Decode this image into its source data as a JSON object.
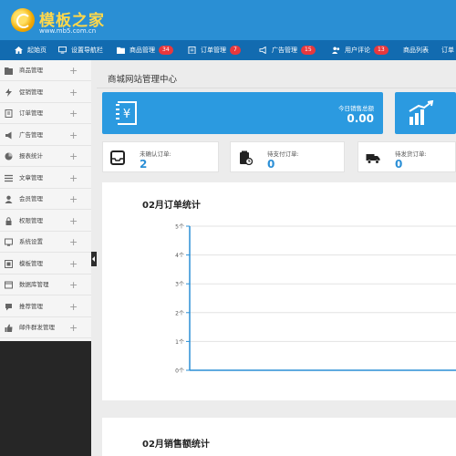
{
  "header": {
    "logo_title": "模板之家",
    "logo_sub": "www.mb5.com.cn"
  },
  "topnav": [
    {
      "label": "起始页",
      "icon": "home-icon"
    },
    {
      "label": "设置导航栏",
      "icon": "monitor-icon"
    },
    {
      "label": "商品管理",
      "icon": "folder-icon",
      "badge": "34"
    },
    {
      "label": "订单管理",
      "icon": "clipboard-icon",
      "badge": "7"
    },
    {
      "label": "广告管理",
      "icon": "megaphone-icon",
      "badge": "15"
    },
    {
      "label": "用户评论",
      "icon": "users-icon",
      "badge": "13"
    },
    {
      "label": "商品列表",
      "icon": ""
    },
    {
      "label": "订单",
      "icon": ""
    }
  ],
  "sidebar": {
    "items": [
      {
        "label": "商品管理",
        "icon": "folder-icon"
      },
      {
        "label": "促销管理",
        "icon": "flash-icon"
      },
      {
        "label": "订单管理",
        "icon": "doc-icon"
      },
      {
        "label": "广告管理",
        "icon": "megaphone-icon"
      },
      {
        "label": "报表统计",
        "icon": "chart-icon"
      },
      {
        "label": "文章管理",
        "icon": "list-icon"
      },
      {
        "label": "会员管理",
        "icon": "user-icon"
      },
      {
        "label": "权限管理",
        "icon": "lock-icon"
      },
      {
        "label": "系统设置",
        "icon": "settings-icon"
      },
      {
        "label": "模板管理",
        "icon": "template-icon"
      },
      {
        "label": "数据库管理",
        "icon": "database-icon"
      },
      {
        "label": "推荐管理",
        "icon": "recommend-icon"
      },
      {
        "label": "邮件群发管理",
        "icon": "thumb-icon"
      }
    ],
    "plus": "+"
  },
  "main": {
    "page_title": "商城网站管理中心",
    "stats": [
      {
        "label": "今日销售总额",
        "value": "0.00",
        "icon": "money-icon"
      },
      {
        "label": "",
        "value": "",
        "icon": "growth-icon"
      }
    ],
    "orders": [
      {
        "label": "未确认订单:",
        "value": "2",
        "icon": "box-icon"
      },
      {
        "label": "待支付订单:",
        "value": "0",
        "icon": "payment-icon"
      },
      {
        "label": "待发货订单:",
        "value": "0",
        "icon": "truck-icon"
      }
    ]
  },
  "charts": {
    "order_title": "02月订单统计",
    "sales_title": "02月销售额统计"
  },
  "chart_data": {
    "type": "line",
    "title": "02月订单统计",
    "xlabel": "",
    "ylabel": "",
    "y_ticks": [
      "0个",
      "1个",
      "2个",
      "3个",
      "4个",
      "5个"
    ],
    "ylim": [
      0,
      5
    ],
    "x": [],
    "series": [
      {
        "values": []
      }
    ],
    "grid": true
  },
  "colors": {
    "header": "#2a8fd4",
    "nav": "#126bb0",
    "accent": "#2b9ae0",
    "badge": "#e8383d"
  }
}
